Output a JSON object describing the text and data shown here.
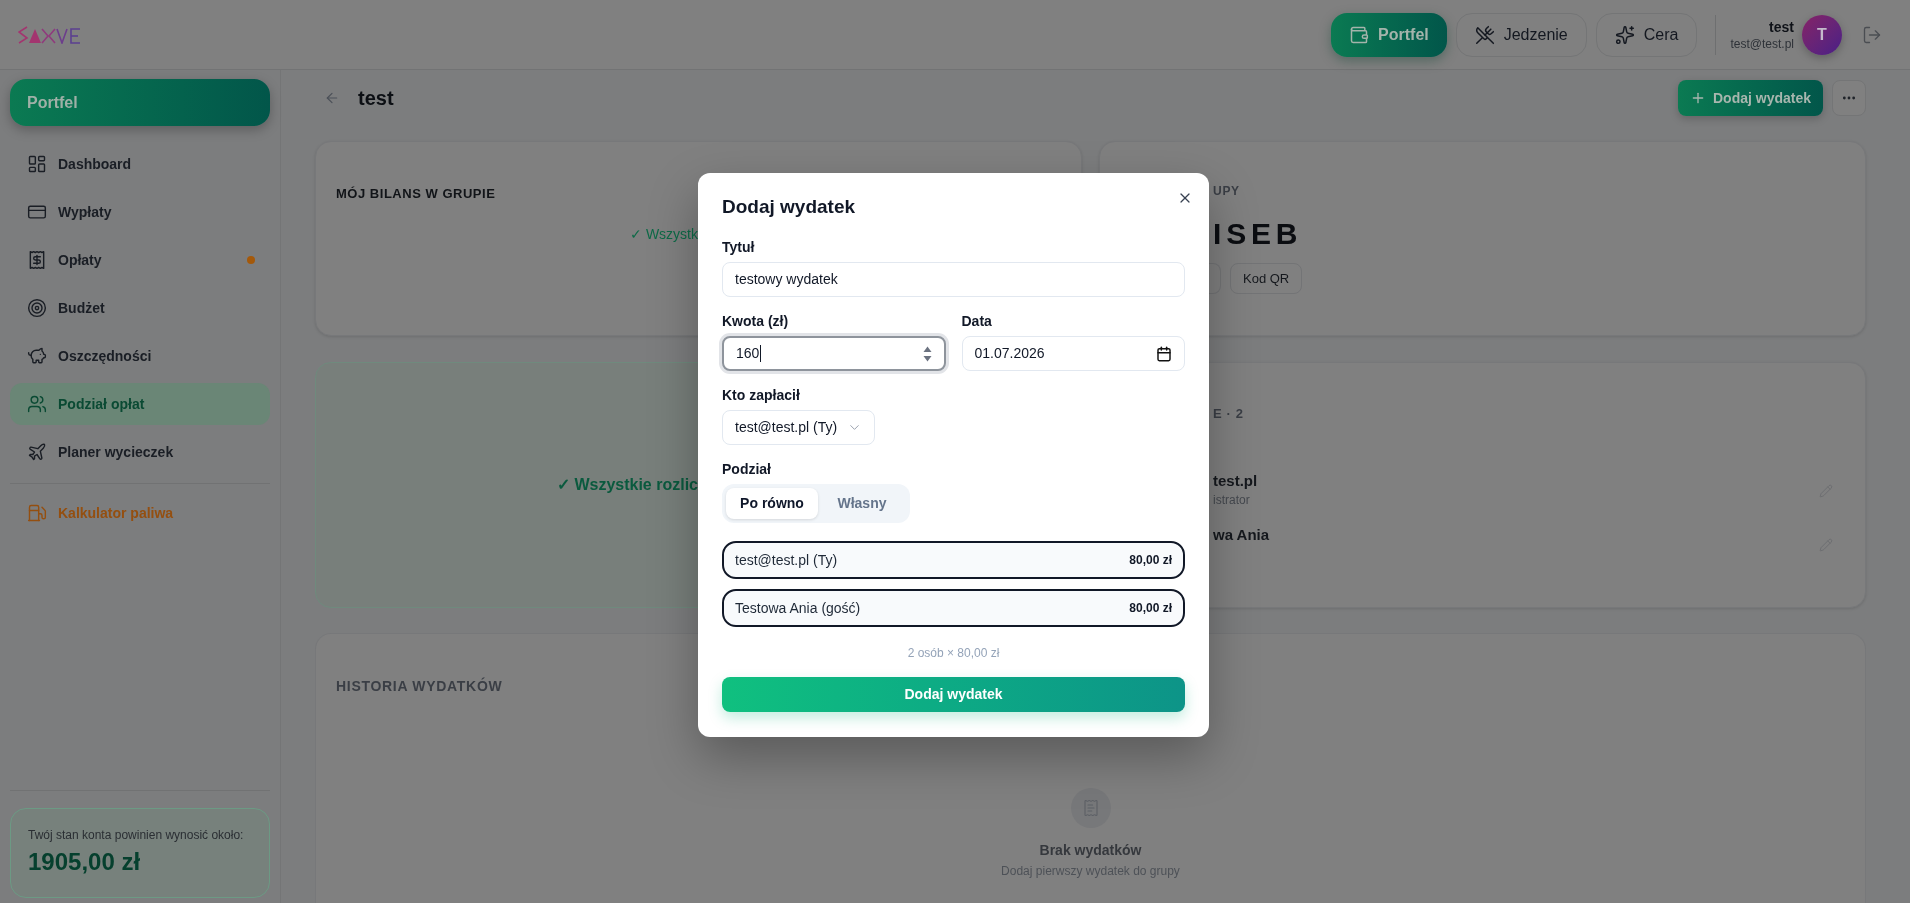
{
  "header": {
    "nav": [
      {
        "label": "Portfel",
        "selected": true
      },
      {
        "label": "Jedzenie",
        "selected": false
      },
      {
        "label": "Cera",
        "selected": false
      }
    ],
    "user": {
      "name": "test",
      "email": "test@test.pl",
      "initial": "T"
    }
  },
  "sidebar": {
    "title": "Portfel",
    "items": [
      {
        "label": "Dashboard",
        "selected": false,
        "has_dot": false
      },
      {
        "label": "Wypłaty",
        "selected": false,
        "has_dot": false
      },
      {
        "label": "Opłaty",
        "selected": false,
        "has_dot": true
      },
      {
        "label": "Budżet",
        "selected": false,
        "has_dot": false
      },
      {
        "label": "Oszczędności",
        "selected": false,
        "has_dot": false
      },
      {
        "label": "Podział opłat",
        "selected": true,
        "has_dot": false
      },
      {
        "label": "Planer wycieczek",
        "selected": false,
        "has_dot": false
      }
    ],
    "tools": [
      {
        "label": "Kalkulator paliwa",
        "selected": false
      }
    ],
    "balance": {
      "label": "Twój stan konta powinien wynosić około:",
      "amount": "1905,00 zł"
    }
  },
  "page": {
    "title": "test",
    "add_button": "Dodaj wydatek"
  },
  "balance_card": {
    "title": "MÓJ BILANS W GRUPIE",
    "status": "✓ Wszystk"
  },
  "group_card": {
    "label": "UPY",
    "code": "ISEB",
    "qr_button": "Kod QR"
  },
  "settlement_card": {
    "status": "✓ Wszystkie rozlic"
  },
  "members_card": {
    "title": "E · 2",
    "members": [
      {
        "name": "test.pl",
        "role": "istrator"
      },
      {
        "name": "wa Ania"
      }
    ]
  },
  "history_card": {
    "title": "HISTORIA WYDATKÓW",
    "empty_title": "Brak wydatków",
    "empty_text": "Dodaj pierwszy wydatek do grupy"
  },
  "modal": {
    "title": "Dodaj wydatek",
    "title_field": {
      "label": "Tytuł",
      "value": "testowy wydatek",
      "focused": false
    },
    "amount_field": {
      "label": "Kwota (zł)",
      "value": "160",
      "focused": true
    },
    "date_field": {
      "label": "Data",
      "value": "01.07.2026",
      "focused": false
    },
    "payer_field": {
      "label": "Kto zapłacił",
      "value": "test@test.pl (Ty)",
      "focused": false
    },
    "split": {
      "label": "Podział",
      "options": [
        {
          "label": "Po równo",
          "selected": true
        },
        {
          "label": "Własny",
          "selected": false
        }
      ]
    },
    "shares": [
      {
        "name": "test@test.pl (Ty)",
        "amount": "80,00 zł"
      },
      {
        "name": "Testowa Ania (gość)",
        "amount": "80,00 zł"
      }
    ],
    "summary": "2 osób × 80,00 zł",
    "submit": "Dodaj wydatek"
  }
}
